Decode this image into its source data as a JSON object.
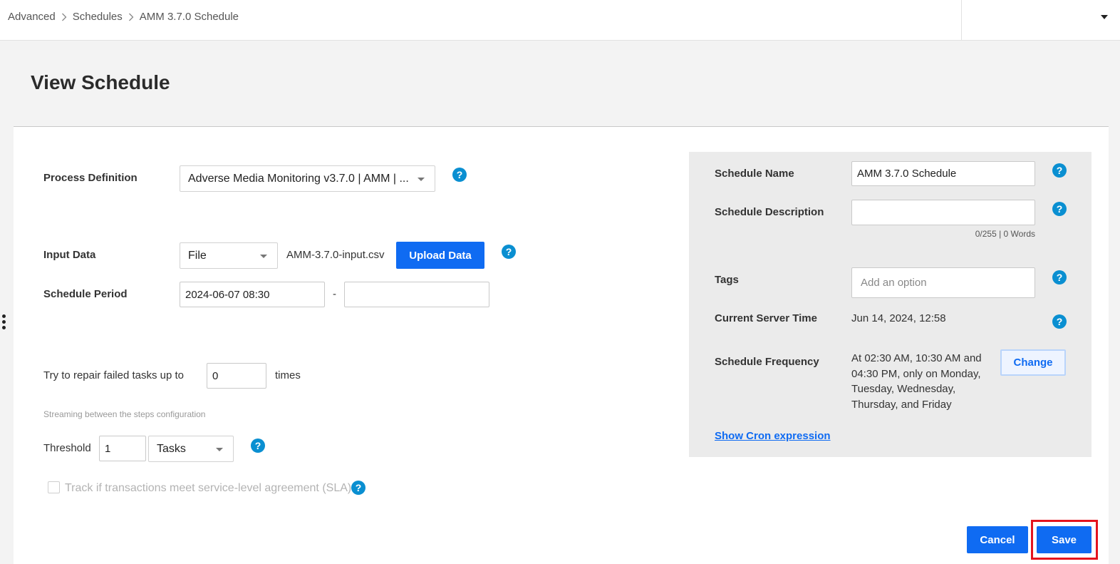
{
  "breadcrumb": {
    "items": [
      "Advanced",
      "Schedules",
      "AMM 3.7.0 Schedule"
    ],
    "separator": "›"
  },
  "page": {
    "title": "View Schedule"
  },
  "form": {
    "process_definition": {
      "label": "Process Definition",
      "value": "Adverse Media Monitoring v3.7.0 | AMM | ..."
    },
    "input_data": {
      "label": "Input Data",
      "type_value": "File",
      "file_name": "AMM-3.7.0-input.csv",
      "upload_label": "Upload Data"
    },
    "schedule_period": {
      "label": "Schedule Period",
      "start": "2024-06-07 08:30",
      "separator": "-",
      "end": ""
    },
    "repair": {
      "prefix": "Try to repair failed tasks up to",
      "value": "0",
      "suffix": "times"
    },
    "streaming": {
      "caption": "Streaming between the steps configuration",
      "threshold_label": "Threshold",
      "threshold_value": "1",
      "unit_value": "Tasks"
    },
    "sla": {
      "label": "Track if transactions meet service-level agreement (SLA)",
      "checked": false
    }
  },
  "details": {
    "schedule_name": {
      "label": "Schedule Name",
      "value": "AMM 3.7.0 Schedule"
    },
    "schedule_description": {
      "label": "Schedule Description",
      "value": "",
      "counter": "0/255 | 0 Words"
    },
    "tags": {
      "label": "Tags",
      "placeholder": "Add an option"
    },
    "server_time": {
      "label": "Current Server Time",
      "value": "Jun 14, 2024, 12:58"
    },
    "frequency": {
      "label": "Schedule Frequency",
      "lines": [
        "At 02:30 AM, 10:30 AM and",
        "04:30 PM, only on Monday,",
        "Tuesday, Wednesday,",
        "Thursday, and Friday"
      ],
      "change_label": "Change"
    },
    "cron_link": "Show Cron expression"
  },
  "footer": {
    "cancel_label": "Cancel",
    "save_label": "Save"
  },
  "icons": {
    "help": "?"
  },
  "colors": {
    "primary": "#0f6bf2",
    "help": "#0a8fd1",
    "highlight": "#e4141e"
  }
}
